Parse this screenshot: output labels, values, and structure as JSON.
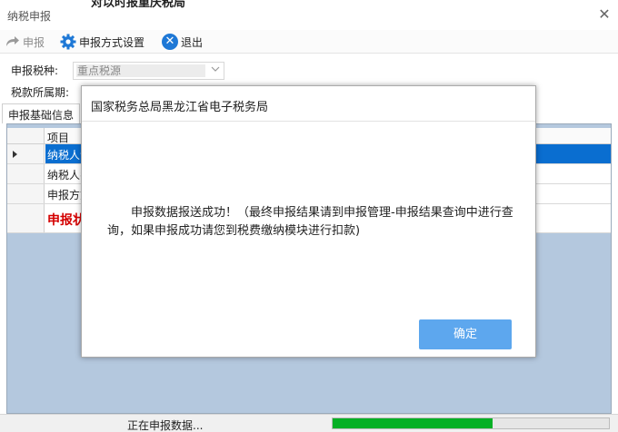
{
  "window": {
    "title": "纳税申报",
    "overflow_title": "对以时报重庆税局",
    "close_glyph": "✕"
  },
  "toolbar": {
    "declare_label": "申报",
    "settings_label": "申报方式设置",
    "exit_label": "退出"
  },
  "form": {
    "tax_type_label": "申报税种:",
    "tax_type_value": "重点税源",
    "period_label": "税款所属期:"
  },
  "tab": {
    "label": "申报基础信息"
  },
  "grid": {
    "column_header": "项目",
    "rows": [
      {
        "item": "纳税人识",
        "selected": true
      },
      {
        "item": "纳税人名",
        "selected": false
      },
      {
        "item": "申报方式",
        "selected": false
      },
      {
        "item": "申报状",
        "selected": false,
        "emphasis": true
      }
    ]
  },
  "status": {
    "text": "正在申报数据...",
    "progress_percent": 58
  },
  "modal": {
    "title": "国家税务总局黑龙江省电子税务局",
    "message": "申报数据报送成功！（最终申报结果请到申报管理-申报结果查询中进行查询，如果申报成功请您到税费缴纳模块进行扣款)",
    "ok_label": "确定"
  },
  "colors": {
    "accent": "#1e78d6",
    "selected_row": "#0a6ed0",
    "grid_bg": "#b4c8de",
    "progress": "#06b025",
    "ok_button": "#5da7ee",
    "emphasis_text": "#d40000"
  }
}
